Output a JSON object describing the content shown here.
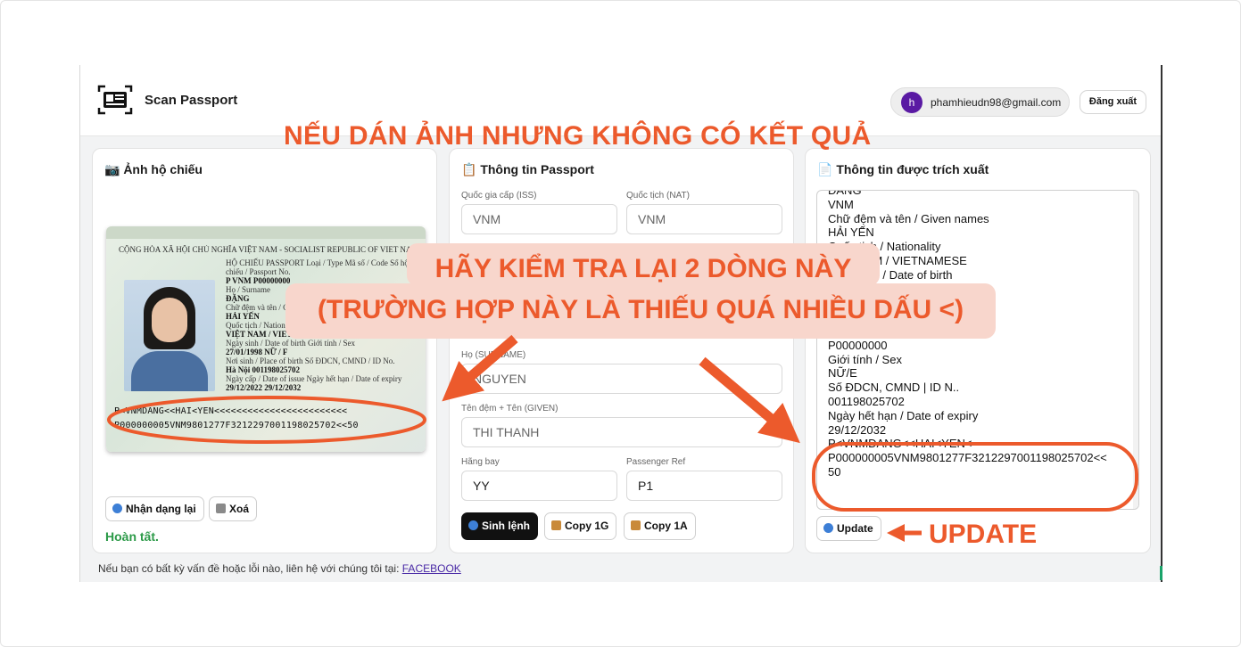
{
  "header": {
    "app_title": "Scan Passport",
    "user_initial": "h",
    "user_email": "phamhieudn98@gmail.com",
    "logout_label": "Đăng xuất"
  },
  "image_card": {
    "title": "📷 Ảnh hộ chiếu",
    "passport": {
      "header": "CỘNG HÒA XÃ HỘI CHỦ NGHĨA VIỆT NAM - SOCIALIST REPUBLIC OF VIET NAM",
      "lines": [
        {
          "label": "HỘ CHIẾU  PASSPORT   Loại / Type  Mã số / Code  Số hộ chiếu / Passport No.",
          "value": ""
        },
        {
          "label": "",
          "value": "P        VNM       P00000000"
        },
        {
          "label": "Họ / Surname",
          "value": "ĐẶNG"
        },
        {
          "label": "Chữ đệm và tên / Given names",
          "value": "HẢI YẾN"
        },
        {
          "label": "Quốc tịch / Nationality",
          "value": "VIỆT NAM / VIETNAMESE"
        },
        {
          "label": "Ngày sinh / Date of birth    Giới tính / Sex",
          "value": "27/01/1998           NỮ / F"
        },
        {
          "label": "Nơi sinh / Place of birth   Số ĐDCN, CMND / ID No.",
          "value": "Hà Nội               001198025702"
        },
        {
          "label": "Ngày cấp / Date of issue   Ngày hết hạn / Date of expiry",
          "value": "29/12/2022           29/12/2032"
        }
      ],
      "mrz_line1": "P<VNMDANG<<HAI<YEN<<<<<<<<<<<<<<<<<<<<<<<<",
      "mrz_line2": "P000000005VNM9801277F3212297001198025702<<50"
    },
    "rescan_label": "Nhận dạng lại",
    "delete_label": "Xoá",
    "status": "Hoàn tất."
  },
  "info_card": {
    "title": "📋 Thông tin Passport",
    "iss_label": "Quốc gia cấp (ISS)",
    "iss_value": "VNM",
    "nat_label": "Quốc tịch (NAT)",
    "nat_value": "VNM",
    "surname_label": "Họ (SURNAME)",
    "surname_value": "NGUYEN",
    "given_label": "Tên đệm + Tên (GIVEN)",
    "given_value": "THI THANH",
    "airline_label": "Hãng bay",
    "airline_value": "YY",
    "pax_label": "Passenger Ref",
    "pax_value": "P1",
    "generate_label": "Sinh lệnh",
    "copy1g_label": "Copy 1G",
    "copy1a_label": "Copy 1A"
  },
  "extract_card": {
    "title": "📄 Thông tin được trích xuất",
    "text": "ĐĂNG\nVNM\nChữ đệm và tên / Given names\nHẢI YẾN\nQuốc tịch / Nationality\nVIỆT NAM / VIETNAMESE\nNgày sinh / Date of birth\n27/01/1998\nHà Nội\nNgày cấp / Date of issue\n29/12/2022\nP00000000\nGiới tính / Sex\nNỮ/E\nSố ĐDCN, CMND | ID N..\n001198025702\nNgày hết hạn / Date of expiry\n29/12/2032\nP<VNMDANG<<HAI<YEN<\nP000000005VNM9801277F3212297001198025702<<\n50",
    "update_label": "Update"
  },
  "footer": {
    "text": "Nếu bạn có bất kỳ vấn đề hoặc lỗi nào, liên hệ với chúng tôi tại: ",
    "link": "FACEBOOK"
  },
  "annotations": {
    "title": "NẾU DÁN ẢNH NHƯNG KHÔNG CÓ KẾT QUẢ",
    "banner_line1": "HÃY KIỂM TRA LẠI 2 DÒNG NÀY",
    "banner_line2": "(TRƯỜNG HỢP NÀY LÀ THIẾU QUÁ NHIỀU DẤU <)",
    "update_callout": "UPDATE",
    "color": "#ec5a2c"
  }
}
